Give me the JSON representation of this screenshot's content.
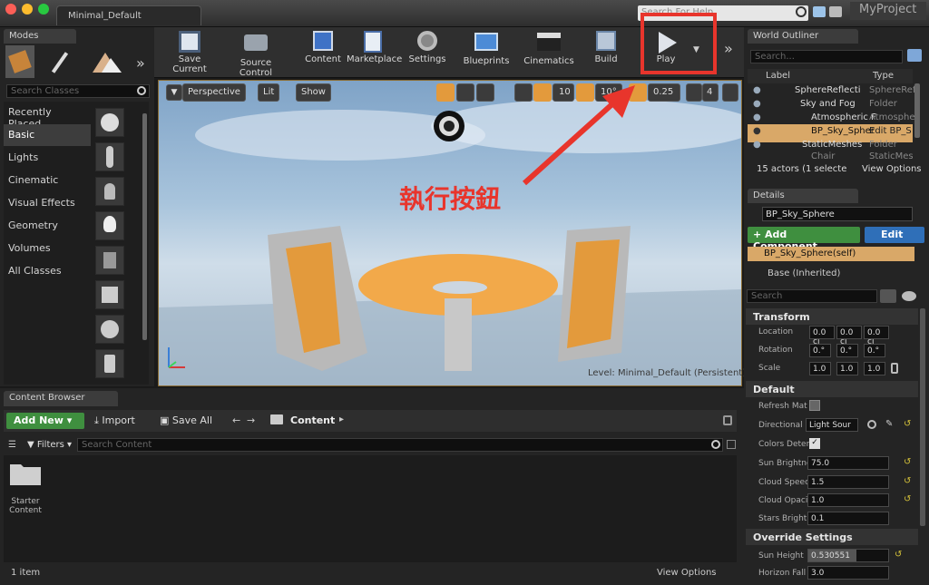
{
  "window": {
    "title_tab": "Minimal_Default",
    "project": "MyProject",
    "help_placeholder": "Search For Help"
  },
  "modes": {
    "tab": "Modes",
    "search_placeholder": "Search Classes",
    "categories": [
      "Recently Placed",
      "Basic",
      "Lights",
      "Cinematic",
      "Visual Effects",
      "Geometry",
      "Volumes",
      "All Classes"
    ],
    "selected": "Basic"
  },
  "toolbar": {
    "buttons": [
      "Save Current",
      "Source Control",
      "Content",
      "Marketplace",
      "Settings",
      "Blueprints",
      "Cinematics",
      "Build",
      "Play"
    ],
    "overflow": "»"
  },
  "viewport": {
    "perspective": "Perspective",
    "lit": "Lit",
    "show": "Show",
    "grid_snap": "10",
    "rot_snap": "10°",
    "scale_snap": "0.25",
    "camera_speed": "4",
    "level_label": "Level:",
    "level_name": "Minimal_Default (Persistent)"
  },
  "annotation": {
    "text": "執行按鈕",
    "color": "#e8352c"
  },
  "outliner": {
    "tab": "World Outliner",
    "search_placeholder": "Search...",
    "col_label": "Label",
    "col_type": "Type",
    "rows": [
      {
        "label": "SphereReflecti",
        "type": "SphereRef"
      },
      {
        "label": "Sky and Fog",
        "type": "Folder"
      },
      {
        "label": "Atmospheric F",
        "type": "Atmosphe"
      },
      {
        "label": "BP_Sky_Spher",
        "type": "Edit BP_S"
      },
      {
        "label": "StaticMeshes",
        "type": "Folder"
      },
      {
        "label": "Chair",
        "type": "StaticMesl"
      }
    ],
    "count": "15 actors (1 selecte",
    "view_options": "View Options"
  },
  "details": {
    "tab": "Details",
    "name": "BP_Sky_Sphere",
    "add_component": "+ Add Component",
    "edit": "Edit",
    "self": "BP_Sky_Sphere(self)",
    "base": "Base (Inherited)",
    "search_placeholder": "Search",
    "transform": "Transform",
    "location": "Location",
    "rotation": "Rotation",
    "scale": "Scale",
    "loc_vals": [
      "0.0 cı",
      "0.0 cı",
      "0.0 cı"
    ],
    "rot_vals": [
      "0.°",
      "0.°",
      "0.°"
    ],
    "scale_vals": [
      "1.0",
      "1.0",
      "1.0"
    ],
    "default": "Default",
    "refresh": "Refresh Mat",
    "directional": "Directional L",
    "directional_val": "Light Sour",
    "colors": "Colors Deter",
    "sun_brightness": "Sun Brightne",
    "sun_brightness_val": "75.0",
    "cloud_speed": "Cloud Speec",
    "cloud_speed_val": "1.5",
    "cloud_opacity": "Cloud Opaci",
    "cloud_opacity_val": "1.0",
    "stars_bright": "Stars Bright",
    "stars_bright_val": "0.1",
    "override": "Override Settings",
    "sun_height": "Sun Height",
    "sun_height_val": "0.530551",
    "horizon": "Horizon Fall",
    "horizon_val": "3.0"
  },
  "content_browser": {
    "tab": "Content Browser",
    "add_new": "Add New",
    "import": "Import",
    "save_all": "Save All",
    "path": "Content",
    "search_placeholder": "Search Content",
    "filters": "Filters",
    "folder": "Starter Content",
    "count": "1 item",
    "view_options": "View Options"
  }
}
